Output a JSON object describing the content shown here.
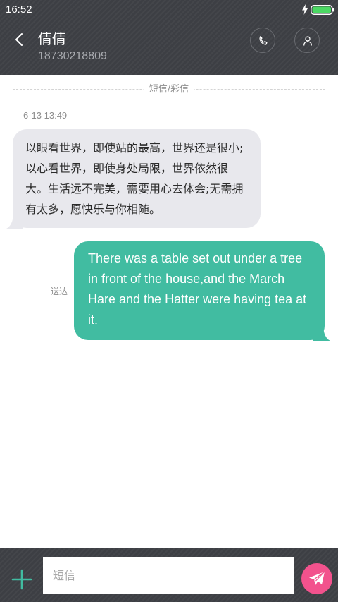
{
  "status_bar": {
    "time": "16:52"
  },
  "header": {
    "contact_name": "倩倩",
    "phone_number": "18730218809"
  },
  "conversation": {
    "divider_label": "短信/彩信",
    "timestamp": "6-13 13:49",
    "messages": [
      {
        "direction": "incoming",
        "text": "以眼看世界，即使站的最高，世界还是很小;以心看世界，即使身处局限，世界依然很大。生活远不完美，需要用心去体会;无需拥有太多，愿快乐与你相随。"
      },
      {
        "direction": "outgoing",
        "text": "There was a table set out under a tree in front of the house,and the March Hare and the Hatter were having tea at it.",
        "status": "送达"
      }
    ]
  },
  "composer": {
    "placeholder": "短信"
  },
  "colors": {
    "header_bg": "#3d3f44",
    "incoming_bubble": "#e8e8ed",
    "outgoing_bubble": "#41bca1",
    "send_button": "#f2528d",
    "battery": "#4cd964",
    "add_icon": "#41bca1"
  },
  "icons": {
    "back": "chevron-left-icon",
    "call": "phone-icon",
    "profile": "person-icon",
    "add": "plus-icon",
    "send": "paper-plane-icon",
    "charging": "lightning-icon",
    "battery": "battery-icon"
  }
}
